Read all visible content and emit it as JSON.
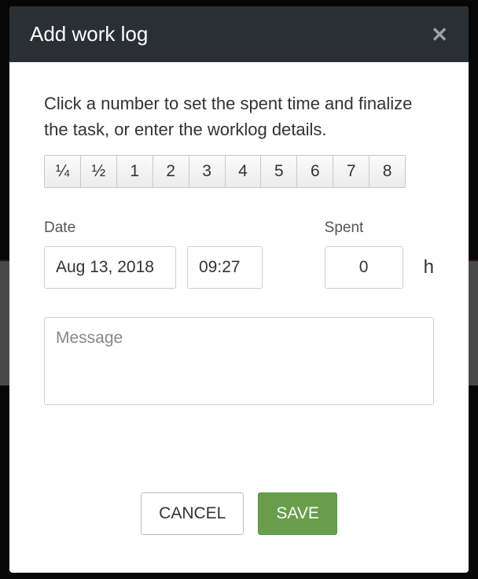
{
  "modal": {
    "title": "Add work log",
    "instruction": "Click a number to set the spent time and finalize the task, or enter the worklog details.",
    "quick_times": [
      "¼",
      "½",
      "1",
      "2",
      "3",
      "4",
      "5",
      "6",
      "7",
      "8"
    ],
    "date": {
      "label": "Date",
      "value": "Aug 13, 2018",
      "time": "09:27"
    },
    "spent": {
      "label": "Spent",
      "value": "0",
      "unit": "h"
    },
    "message_placeholder": "Message",
    "buttons": {
      "cancel": "CANCEL",
      "save": "SAVE"
    }
  }
}
